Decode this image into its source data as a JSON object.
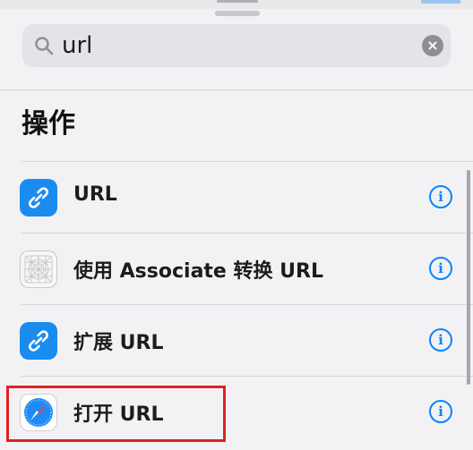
{
  "search": {
    "query": "url",
    "clear_glyph": "×"
  },
  "section": {
    "title": "操作"
  },
  "list": [
    {
      "label": "URL",
      "icon": "link-icon",
      "info_glyph": "i"
    },
    {
      "label": "使用 Associate 转换 URL",
      "icon": "associate-grid-icon",
      "info_glyph": "i"
    },
    {
      "label": "扩展 URL",
      "icon": "link-icon",
      "info_glyph": "i"
    },
    {
      "label": "打开 URL",
      "icon": "safari-compass-icon",
      "info_glyph": "i"
    }
  ],
  "colors": {
    "accent": "#0a84ff",
    "icon_blue": "#1a8cf0",
    "highlight": "#e02020"
  }
}
